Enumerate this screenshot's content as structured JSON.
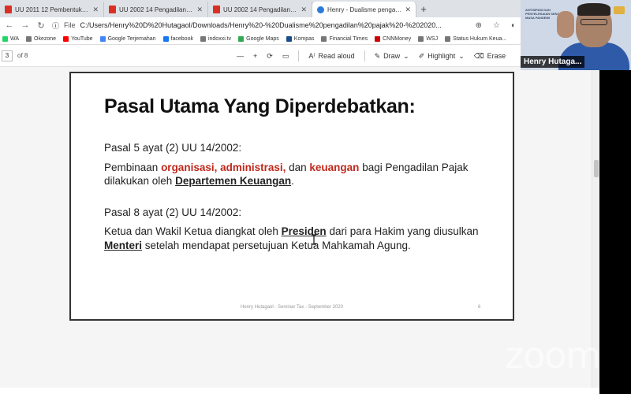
{
  "tabs": [
    {
      "title": "UU 2011 12 Pembentukan Perat",
      "icon": "pdf-icon"
    },
    {
      "title": "UU 2002 14 Pengadilan Pajak.p",
      "icon": "pdf-icon"
    },
    {
      "title": "UU 2002 14 Pengadilan Pajak.p",
      "icon": "pdf-icon"
    },
    {
      "title": "Henry - Dualisme pengadilan pa",
      "icon": "edge-icon",
      "active": true
    }
  ],
  "address": {
    "file_label": "File",
    "url": "C:/Users/Henry%20D%20Hutagaol/Downloads/Henry%20-%20Dualisme%20pengadilan%20pajak%20-%202020..."
  },
  "bookmarks": [
    {
      "label": "WA",
      "color": "#25d366"
    },
    {
      "label": "Okezone",
      "color": "#777"
    },
    {
      "label": "YouTube",
      "color": "#ff0000"
    },
    {
      "label": "Google Terjemahan",
      "color": "#4285f4"
    },
    {
      "label": "facebook",
      "color": "#1877f2"
    },
    {
      "label": "indoxxi.tv",
      "color": "#777"
    },
    {
      "label": "Google Maps",
      "color": "#34a853"
    },
    {
      "label": "Kompas",
      "color": "#1a4d8c"
    },
    {
      "label": "Financial Times",
      "color": "#777"
    },
    {
      "label": "CNNMoney",
      "color": "#cc0000"
    },
    {
      "label": "WSJ",
      "color": "#777"
    },
    {
      "label": "Status Hukum Keua...",
      "color": "#777"
    }
  ],
  "pdf_toolbar": {
    "page": "3",
    "page_total": "of 8",
    "minus": "—",
    "plus": "+",
    "read_aloud": "Read aloud",
    "draw": "Draw",
    "highlight": "Highlight",
    "erase": "Erase"
  },
  "slide": {
    "title": "Pasal Utama Yang Diperdebatkan:",
    "section1_heading": "Pasal 5 ayat (2) UU 14/2002:",
    "s1_a": "Pembinaan ",
    "s1_red1": "organisasi, administrasi,",
    "s1_b": " dan ",
    "s1_red2": "keuangan",
    "s1_c": " bagi Pengadilan Pajak dilakukan oleh ",
    "s1_ul": "Departemen Keuangan",
    "s1_d": ".",
    "section2_heading": "Pasal 8 ayat (2) UU 14/2002:",
    "s2_a": "Ketua dan Wakil Ketua diangkat oleh ",
    "s2_ul1": "Presiden",
    "s2_b": " dari para Hakim yang diusulkan ",
    "s2_ul2": "Menteri",
    "s2_c": " setelah mendapat persetujuan Ketua Mahkamah Agung.",
    "footer": "Henry Hutagaol - Seminar Tax - September 2020",
    "page_number": "6"
  },
  "video": {
    "participant_name": "Henry Hutaga...",
    "background_text": "ANTISIPASI DAN PENYELESAIAN SENGKETA DI MASA PANDEMI"
  },
  "watermark": "zoom"
}
